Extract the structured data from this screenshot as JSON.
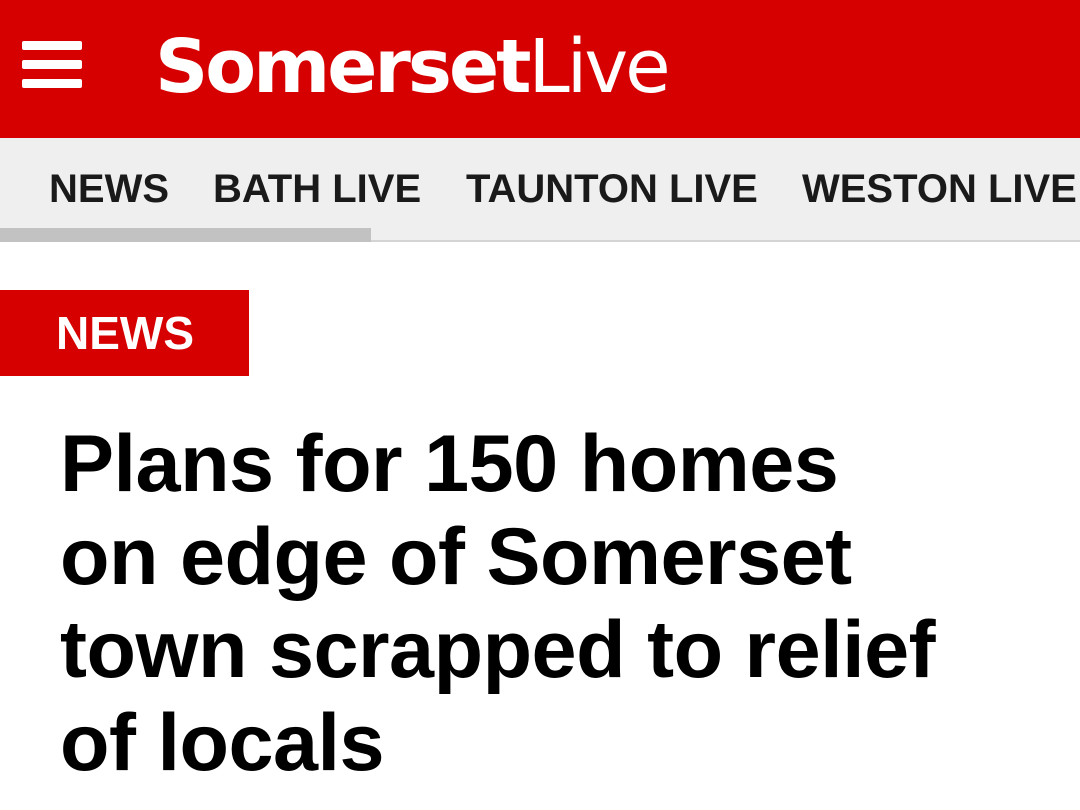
{
  "header": {
    "menu_icon": "hamburger-menu-icon",
    "logo_bold": "Somerset",
    "logo_light": "Live",
    "background_color": "#d70000"
  },
  "nav": {
    "items": [
      "NEWS",
      "BATH LIVE",
      "TAUNTON LIVE",
      "WESTON LIVE"
    ]
  },
  "article": {
    "category": "NEWS",
    "headline_lines": [
      "Plans for 150 homes",
      "on edge of Somerset",
      "town scrapped to relief",
      "of locals"
    ]
  }
}
